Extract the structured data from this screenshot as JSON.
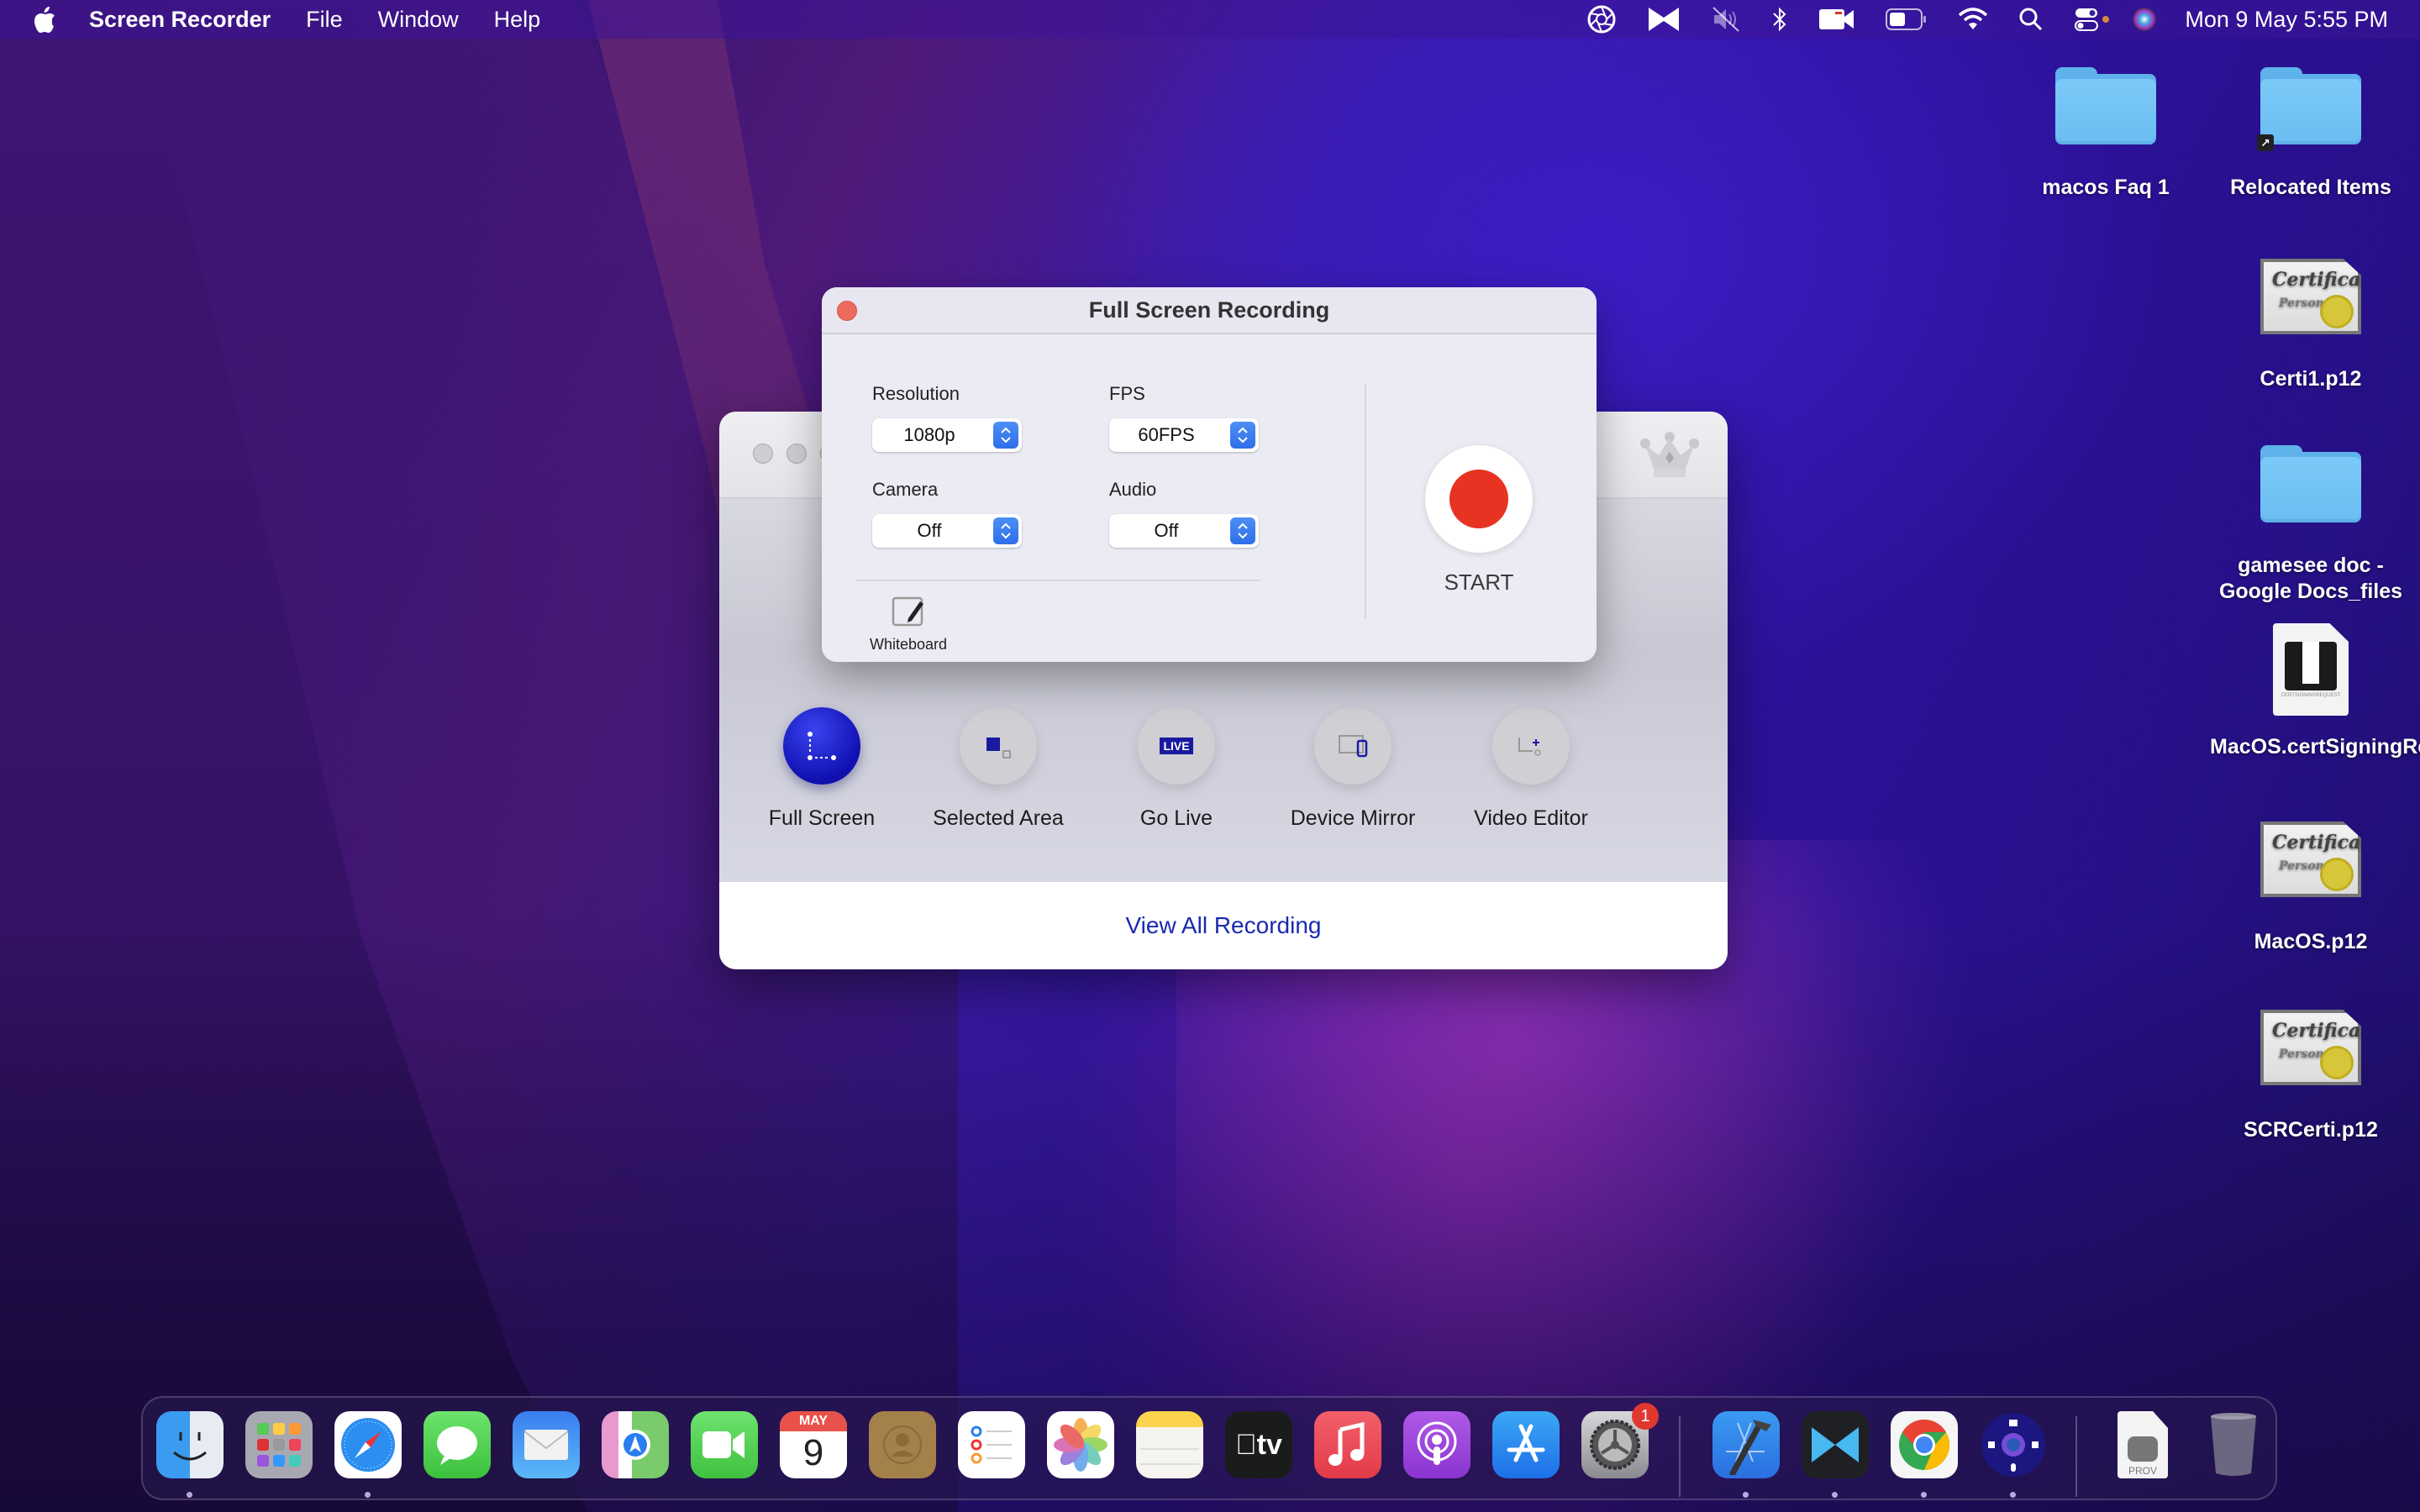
{
  "menubar": {
    "app_name": "Screen Recorder",
    "menus": [
      "File",
      "Window",
      "Help"
    ],
    "status_icons": [
      "aperture-icon",
      "screenrec-icon",
      "mute-icon",
      "bluetooth-icon",
      "facetime-camera-icon",
      "battery-icon",
      "wifi-icon",
      "spotlight-icon",
      "control-center-icon",
      "siri-icon"
    ],
    "clock": "Mon 9 May  5:55 PM"
  },
  "desktop": {
    "items": [
      {
        "name": "macos Faq 1",
        "type": "folder"
      },
      {
        "name": "Relocated Items",
        "type": "folder-alias"
      },
      {
        "name": "Certi1.p12",
        "type": "certificate"
      },
      {
        "name": "gamesee doc - Google Docs_files",
        "type": "folder"
      },
      {
        "name": "MacOS.certSigningRequest",
        "type": "csr"
      },
      {
        "name": "MacOS.p12",
        "type": "certificate"
      },
      {
        "name": "SCRCerti.p12",
        "type": "certificate"
      }
    ],
    "cert_script": "Certificate",
    "cert_sub": "Personal",
    "csr_label": "CERTSIGNINGREQUEST"
  },
  "main_window": {
    "modes": [
      {
        "label": "Full Screen",
        "active": true
      },
      {
        "label": "Selected Area",
        "active": false
      },
      {
        "label": "Go Live",
        "active": false
      },
      {
        "label": "Device Mirror",
        "active": false
      },
      {
        "label": "Video Editor",
        "active": false
      }
    ],
    "live_badge": "LIVE",
    "view_all_label": "View All Recording"
  },
  "dialog": {
    "title": "Full Screen Recording",
    "fields": {
      "resolution": {
        "label": "Resolution",
        "value": "1080p"
      },
      "fps": {
        "label": "FPS",
        "value": "60FPS"
      },
      "camera": {
        "label": "Camera",
        "value": "Off"
      },
      "audio": {
        "label": "Audio",
        "value": "Off"
      }
    },
    "whiteboard_label": "Whiteboard",
    "start_label": "START"
  },
  "dock": {
    "apps": [
      {
        "name": "Finder",
        "running": true
      },
      {
        "name": "Launchpad",
        "running": false
      },
      {
        "name": "Safari",
        "running": true
      },
      {
        "name": "Messages",
        "running": false
      },
      {
        "name": "Mail",
        "running": false
      },
      {
        "name": "Maps",
        "running": false
      },
      {
        "name": "FaceTime",
        "running": false
      },
      {
        "name": "Calendar",
        "running": false
      },
      {
        "name": "Contacts",
        "running": false
      },
      {
        "name": "Reminders",
        "running": false
      },
      {
        "name": "Photos",
        "running": false
      },
      {
        "name": "Notes",
        "running": false
      },
      {
        "name": "Apple TV",
        "running": false
      },
      {
        "name": "Music",
        "running": false
      },
      {
        "name": "Podcasts",
        "running": false
      },
      {
        "name": "App Store",
        "running": false
      },
      {
        "name": "System Preferences",
        "running": false,
        "badge": "1"
      },
      {
        "name": "Xcode",
        "running": true
      },
      {
        "name": "Screen Recorder Video",
        "running": true
      },
      {
        "name": "Google Chrome",
        "running": true
      },
      {
        "name": "Screen Recorder",
        "running": true
      }
    ],
    "calendar_month": "MAY",
    "calendar_day": "9",
    "tv_label": "tv",
    "prov_label": "PROV",
    "trash": "Trash"
  }
}
